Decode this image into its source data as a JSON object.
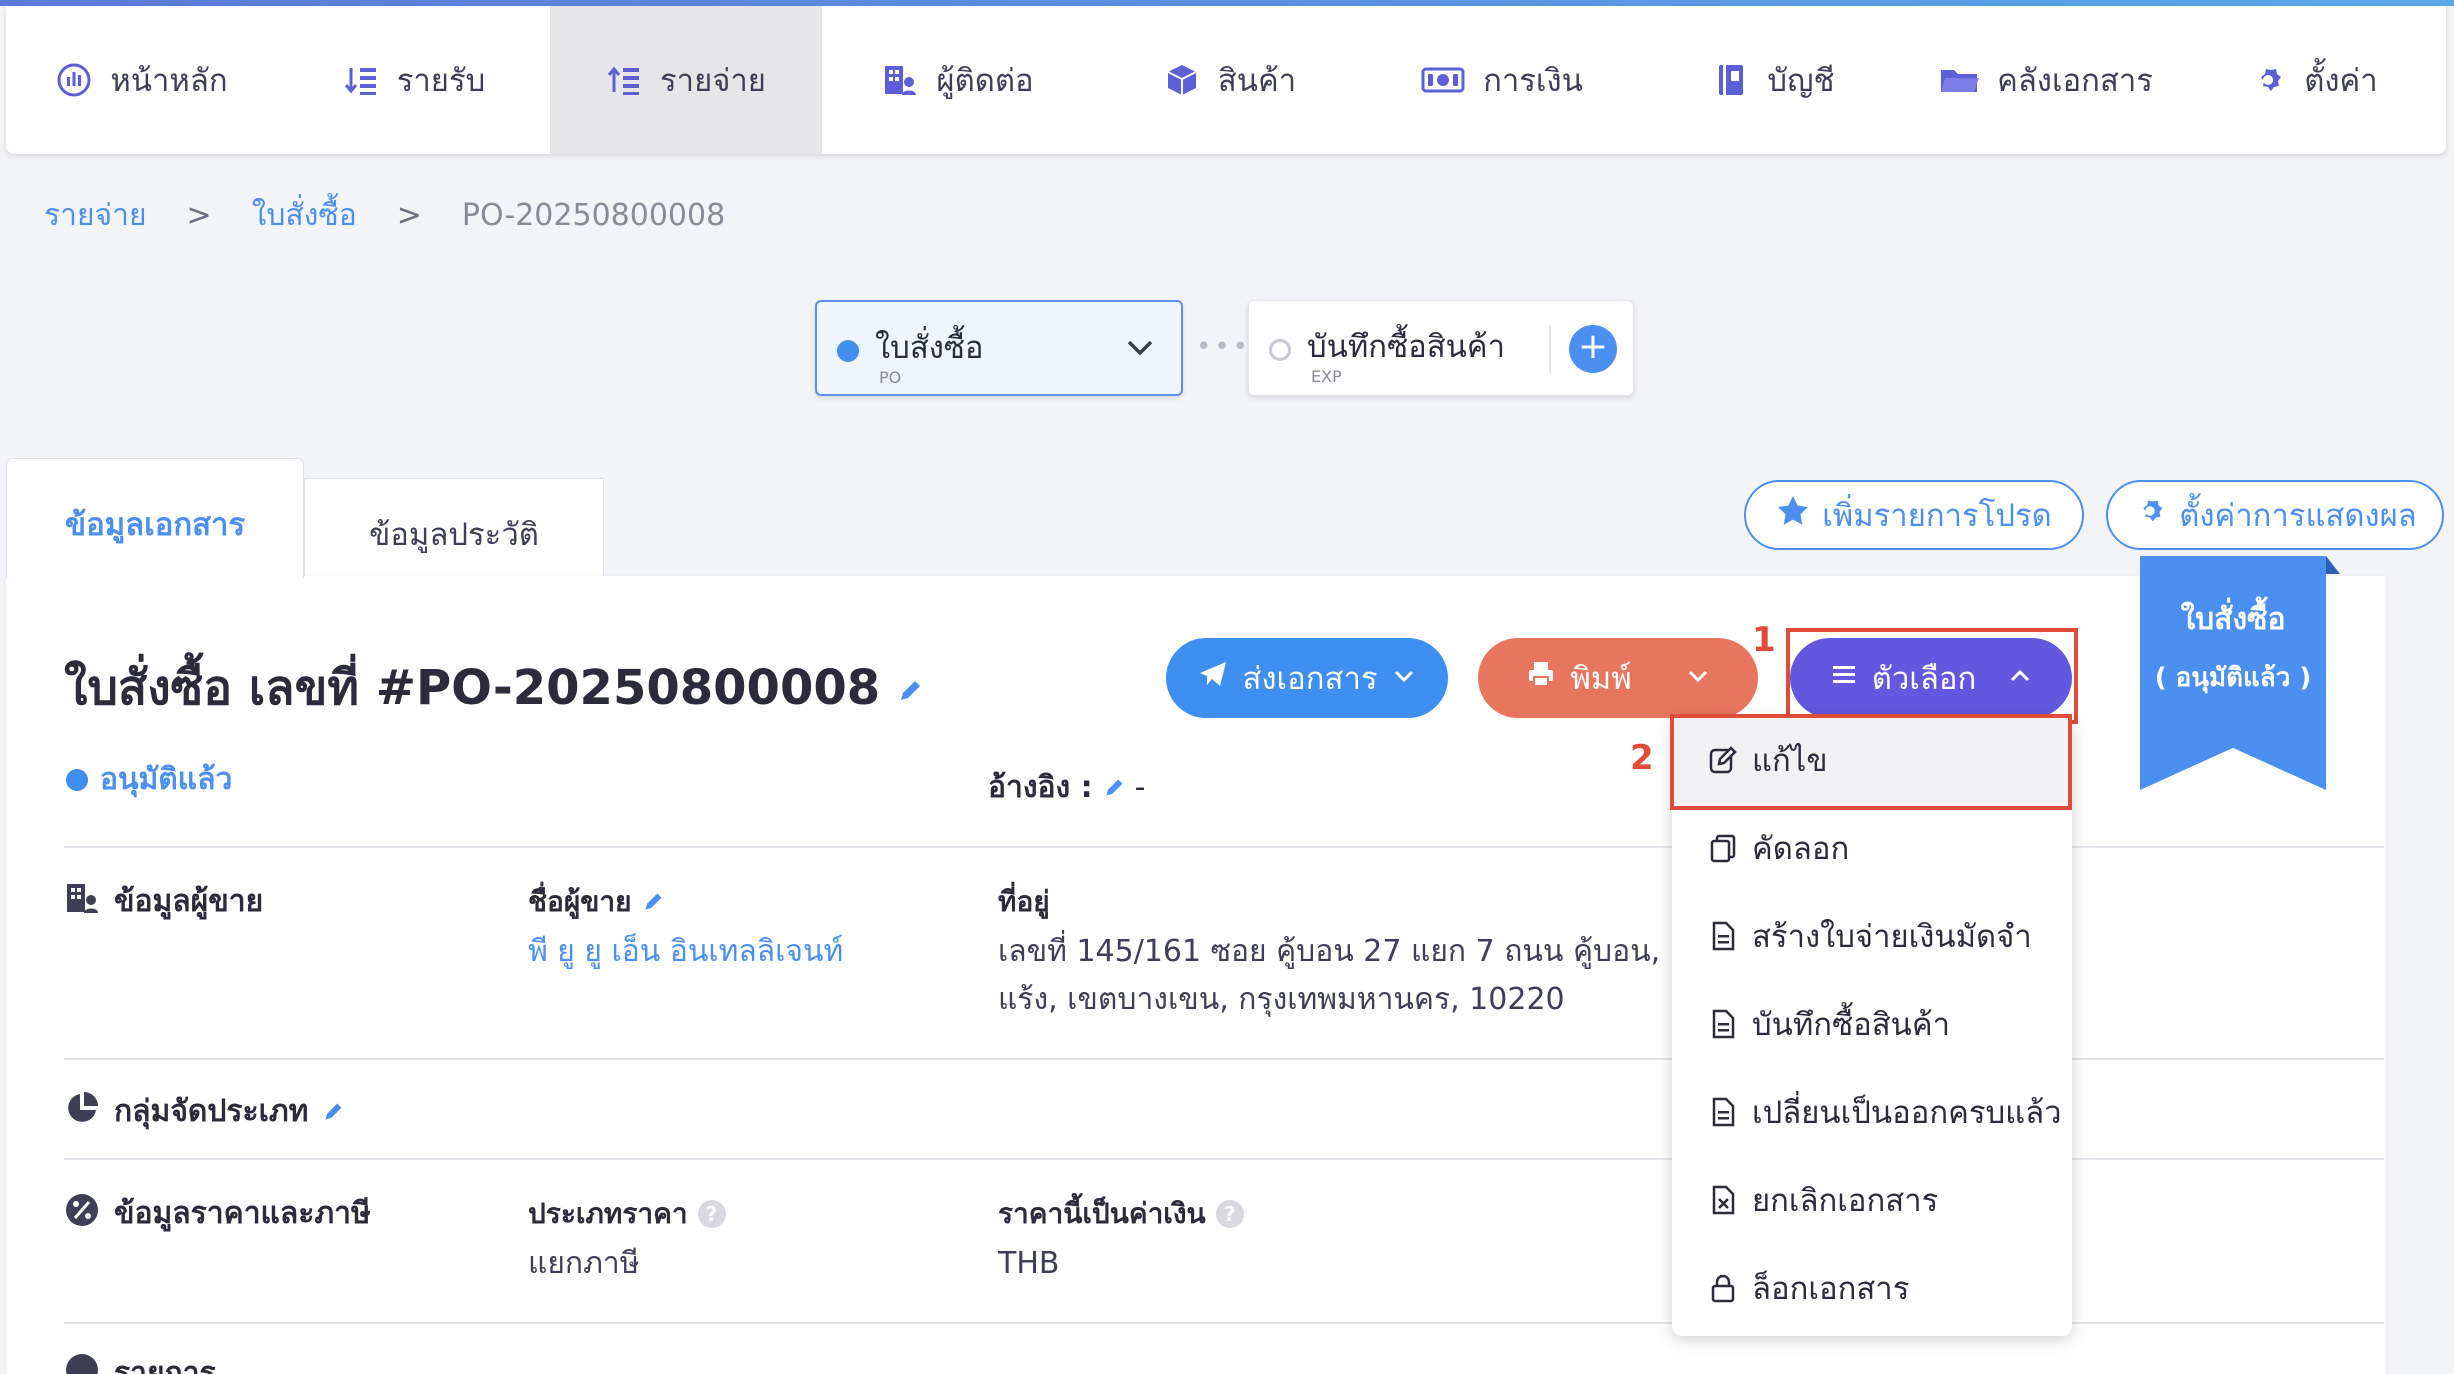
{
  "nav": {
    "items": [
      {
        "label": "หน้าหลัก",
        "icon": "dashboard-icon"
      },
      {
        "label": "รายรับ",
        "icon": "income-sort-icon"
      },
      {
        "label": "รายจ่าย",
        "icon": "expense-sort-icon",
        "active": true
      },
      {
        "label": "ผู้ติดต่อ",
        "icon": "building-contacts-icon"
      },
      {
        "label": "สินค้า",
        "icon": "box-icon"
      },
      {
        "label": "การเงิน",
        "icon": "money-icon"
      },
      {
        "label": "บัญชี",
        "icon": "book-icon"
      },
      {
        "label": "คลังเอกสาร",
        "icon": "folder-icon"
      },
      {
        "label": "ตั้งค่า",
        "icon": "gear-icon"
      }
    ]
  },
  "breadcrumb": {
    "level1": "รายจ่าย",
    "sep": ">",
    "level2": "ใบสั่งซื้อ",
    "current": "PO-20250800008"
  },
  "flow": {
    "po_title": "ใบสั่งซื้อ",
    "po_sub": "PO",
    "dots": "•••",
    "exp_title": "บันทึกซื้อสินค้า",
    "exp_sub": "EXP",
    "add": "+"
  },
  "tabs": {
    "doc_info": "ข้อมูลเอกสาร",
    "history": "ข้อมูลประวัติ"
  },
  "top_actions": {
    "favorite": "เพิ่มรายการโปรด",
    "display_settings": "ตั้งค่าการแสดงผล"
  },
  "document": {
    "title": "ใบสั่งซื้อ เลขที่ #PO-20250800008",
    "status": "อนุมัติแล้ว",
    "reference_label": "อ้างอิง :",
    "reference_value": "-"
  },
  "actions": {
    "send": "ส่งเอกสาร",
    "print": "พิมพ์",
    "options": "ตัวเลือก"
  },
  "annotations": {
    "step1": "1",
    "step2": "2",
    "highlight_color": "#e04b3a"
  },
  "ribbon": {
    "line1": "ใบสั่งซื้อ",
    "line2": "( อนุมัติแล้ว )"
  },
  "dropdown": {
    "items": [
      {
        "label": "แก้ไข",
        "icon": "edit-icon"
      },
      {
        "label": "คัดลอก",
        "icon": "copy-icon"
      },
      {
        "label": "สร้างใบจ่ายเงินมัดจำ",
        "icon": "document-icon"
      },
      {
        "label": "บันทึกซื้อสินค้า",
        "icon": "document-icon"
      },
      {
        "label": "เปลี่ยนเป็นออกครบแล้ว",
        "icon": "document-icon"
      },
      {
        "label": "ยกเลิกเอกสาร",
        "icon": "cancel-document-icon"
      },
      {
        "label": "ล็อกเอกสาร",
        "icon": "lock-icon"
      }
    ]
  },
  "seller": {
    "section": "ข้อมูลผู้ขาย",
    "name_label": "ชื่อผู้ขาย",
    "name_value": "พี ยู ยู เอ็น อินเทลลิเจนท์",
    "address_label": "ที่อยู่",
    "address_line1": "เลขที่ 145/161 ซอย คู้บอน 27 แยก 7 ถนน คู้บอน, แขว",
    "address_line2": "แร้ง, เขตบางเขน, กรุงเทพมหานคร, 10220"
  },
  "classification": {
    "section": "กลุ่มจัดประเภท"
  },
  "pricing": {
    "section": "ข้อมูลราคาและภาษี",
    "price_type_label": "ประเภทราคา",
    "price_type_value": "แยกภาษี",
    "currency_label": "ราคานี้เป็นค่าเงิน",
    "currency_value": "THB"
  },
  "items_section": {
    "section": "รายการ"
  },
  "colors": {
    "primary_blue": "#4b8ff0",
    "nav_icon_purple": "#5d5fd6",
    "send_button": "#3f8ff0",
    "print_button": "#e8765e",
    "options_button": "#6258e0"
  }
}
